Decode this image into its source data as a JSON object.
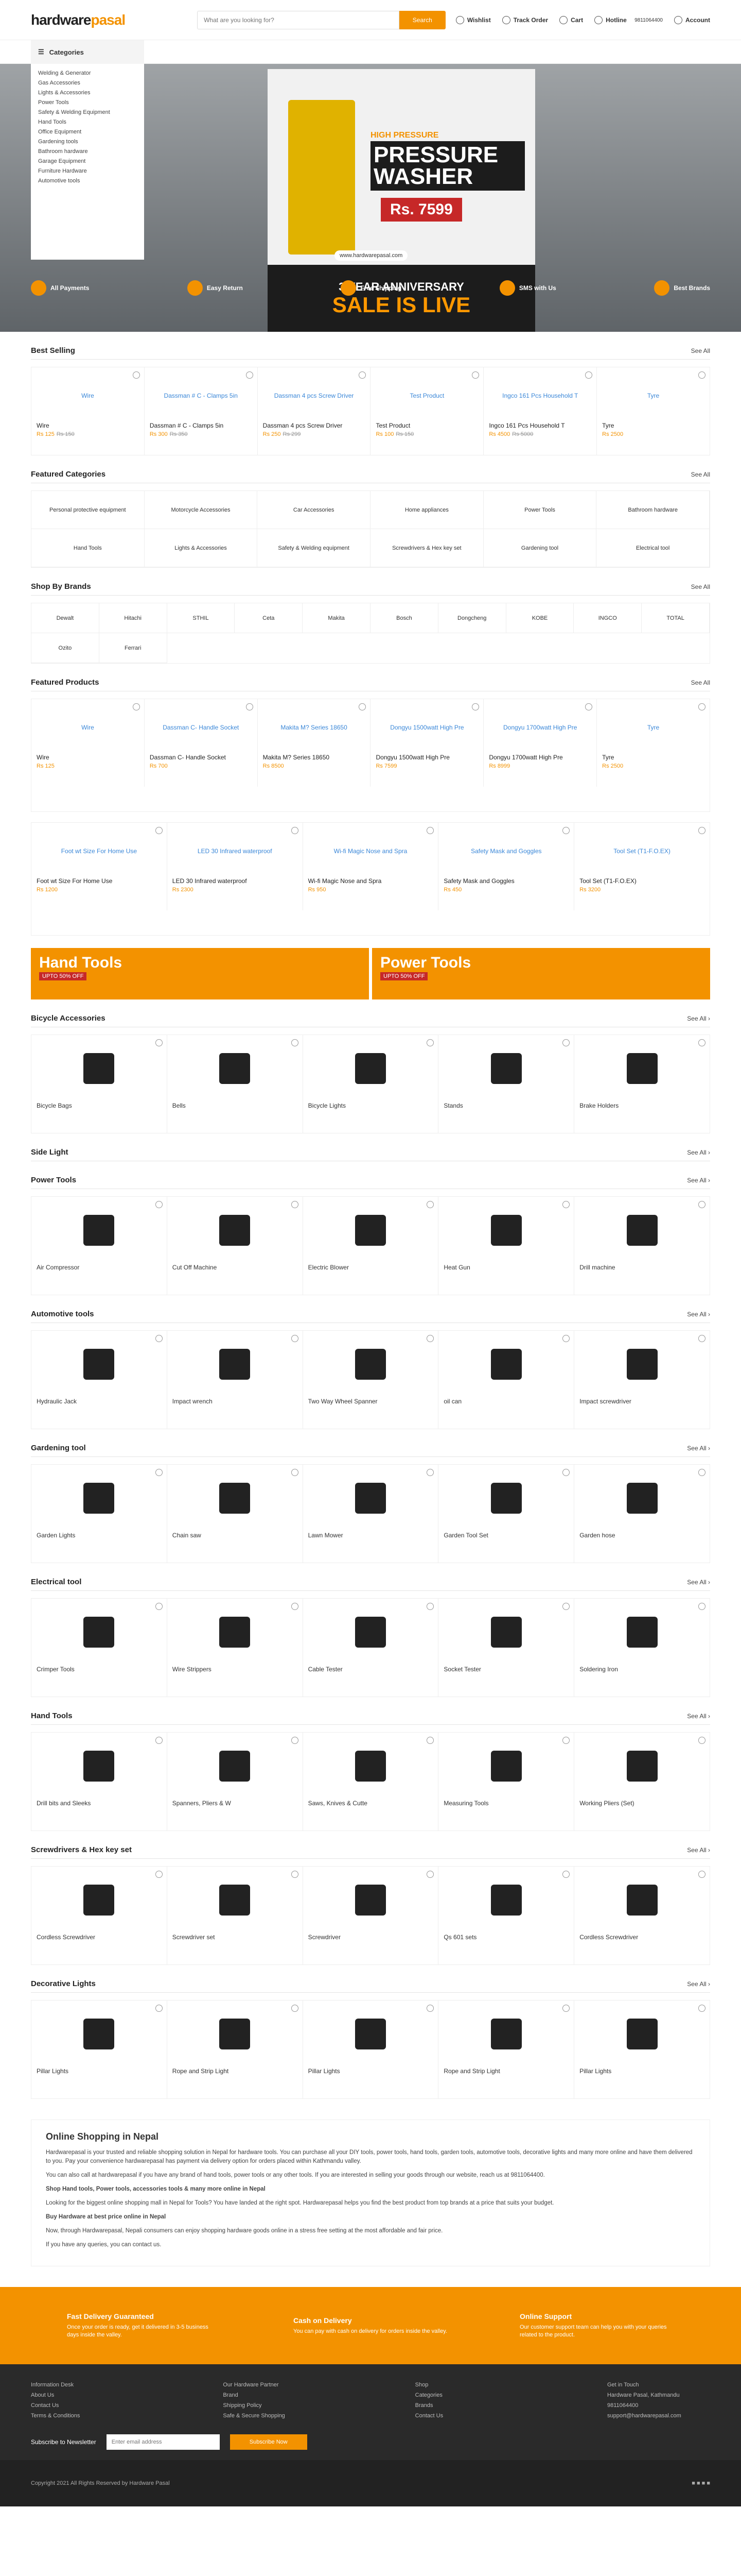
{
  "header": {
    "logo_a": "hardware",
    "logo_b": "pasal",
    "search_placeholder": "What are you looking for?",
    "search_btn": "Search",
    "wishlist": "Wishlist",
    "track": "Track Order",
    "cart": "Cart",
    "hotline": "Hotline",
    "phone": "9811064400",
    "account": "Account",
    "categories": "Categories"
  },
  "sidebar": [
    "Welding & Generator",
    "Gas Accessories",
    "Lights & Accessories",
    "Power Tools",
    "Safety & Welding Equipment",
    "Hand Tools",
    "Office Equipment",
    "Gardening tools",
    "Bathroom hardware",
    "Garage Equipment",
    "Furniture Hardware",
    "Automotive tools"
  ],
  "hero": {
    "tag": "HIGH PRESSURE",
    "title": "PRESSURE WASHER",
    "price": "Rs. 7599",
    "url": "www.hardwarepasal.com",
    "anniv_1": "3 YEAR ANNIVERSARY",
    "anniv_2": "SALE IS LIVE"
  },
  "features": [
    "All Payments",
    "Easy Return",
    "Free Shipping",
    "SMS with Us",
    "Best Brands"
  ],
  "best_selling": {
    "title": "Best Selling",
    "see_all": "See All",
    "items": [
      {
        "name": "Wire",
        "price": "Rs 125",
        "old": "Rs 150"
      },
      {
        "name": "Dassman # C - Clamps 5in",
        "price": "Rs 300",
        "old": "Rs 350"
      },
      {
        "name": "Dassman 4 pcs Screw Driver",
        "price": "Rs 250",
        "old": "Rs 299"
      },
      {
        "name": "Test Product",
        "price": "Rs 100",
        "old": "Rs 150"
      },
      {
        "name": "Ingco 161 Pcs Household T",
        "price": "Rs 4500",
        "old": "Rs 5000"
      },
      {
        "name": "Tyre",
        "price": "Rs 2500",
        "old": ""
      }
    ]
  },
  "featured_categories": {
    "title": "Featured Categories",
    "see_all": "See All",
    "items": [
      "Personal protective equipment",
      "Motorcycle Accessories",
      "Car Accessories",
      "Home appliances",
      "Power Tools",
      "Bathroom hardware",
      "Hand Tools",
      "Lights & Accessories",
      "Safety & Welding equipment",
      "Screwdrivers & Hex key set",
      "Gardening tool",
      "Electrical tool"
    ]
  },
  "brands": {
    "title": "Shop By Brands",
    "see_all": "See All",
    "items": [
      "Dewalt",
      "Hitachi",
      "STHIL",
      "Ceta",
      "Makita",
      "Bosch",
      "Dongcheng",
      "KOBE",
      "INGCO",
      "TOTAL",
      "Ozito",
      "Ferrari"
    ]
  },
  "featured_products": {
    "title": "Featured Products",
    "see_all": "See All",
    "row1": [
      {
        "name": "Wire",
        "price": "Rs 125"
      },
      {
        "name": "Dassman C- Handle Socket",
        "price": "Rs 700"
      },
      {
        "name": "Makita M? Series 18650",
        "price": "Rs 8500"
      },
      {
        "name": "Dongyu 1500watt High Pre",
        "price": "Rs 7599"
      },
      {
        "name": "Dongyu 1700watt High Pre",
        "price": "Rs 8999"
      },
      {
        "name": "Tyre",
        "price": "Rs 2500"
      }
    ],
    "row2": [
      {
        "name": "Foot wt Size For Home Use",
        "price": "Rs 1200"
      },
      {
        "name": "LED 30 Infrared waterproof",
        "price": "Rs 2300"
      },
      {
        "name": "Wi-fi Magic Nose and Spra",
        "price": "Rs 950"
      },
      {
        "name": "Safety Mask and Goggles",
        "price": "Rs 450"
      },
      {
        "name": "Tool Set (T1-F.O.EX)",
        "price": "Rs 3200"
      }
    ]
  },
  "banners": [
    {
      "title": "Hand Tools",
      "tag": "UPTO 50% OFF"
    },
    {
      "title": "Power Tools",
      "tag": "UPTO 50% OFF"
    }
  ],
  "sections": [
    {
      "title": "Bicycle Accessories",
      "items": [
        "Bicycle Bags",
        "Bells",
        "Bicycle Lights",
        "Stands",
        "Brake Holders"
      ]
    },
    {
      "title": "Side Light",
      "items": []
    },
    {
      "title": "Power Tools",
      "items": [
        "Air Compressor",
        "Cut Off Machine",
        "Electric Blower",
        "Heat Gun",
        "Drill machine"
      ]
    },
    {
      "title": "Automotive tools",
      "items": [
        "Hydraulic Jack",
        "Impact wrench",
        "Two Way Wheel Spanner",
        "oil can",
        "Impact screwdriver"
      ]
    },
    {
      "title": "Gardening tool",
      "items": [
        "Garden Lights",
        "Chain saw",
        "Lawn Mower",
        "Garden Tool Set",
        "Garden hose"
      ]
    },
    {
      "title": "Electrical tool",
      "items": [
        "Crimper Tools",
        "Wire Strippers",
        "Cable Tester",
        "Socket Tester",
        "Soldering Iron"
      ]
    },
    {
      "title": "Hand Tools",
      "items": [
        "Drill bits and Sleeks",
        "Spanners, Pliers & W",
        "Saws, Knives & Cutte",
        "Measuring Tools",
        "Working Pliers (Set)"
      ]
    },
    {
      "title": "Screwdrivers & Hex key set",
      "items": [
        "Cordless Screwdriver",
        "Screwdriver set",
        "Screwdriver",
        "Qs 601 sets",
        "Cordless Screwdriver"
      ]
    },
    {
      "title": "Decorative Lights",
      "items": [
        "Pillar Lights",
        "Rope and Strip Light",
        "Pillar Lights",
        "Rope and Strip Light",
        "Pillar Lights"
      ]
    }
  ],
  "about": {
    "title": "Online Shopping in Nepal",
    "p1": "Hardwarepasal is your trusted and reliable shopping solution in Nepal for hardware tools. You can purchase all your DIY tools, power tools, hand tools, garden tools, automotive tools, decorative lights and many more online and have them delivered to you. Pay your convenience hardwarepasal has payment via delivery option for orders placed within Kathmandu valley.",
    "p2": "You can also call at hardwarepasal if you have any brand of hand tools, power tools or any other tools. If you are interested in selling your goods through our website, reach us at 9811064400.",
    "h": "Shop Hand tools, Power tools, accessories tools & many more online in Nepal",
    "p3": "Looking for the biggest online shopping mall in Nepal for Tools? You have landed at the right spot. Hardwarepasal helps you find the best product from top brands at a price that suits your budget.",
    "p4": "Buy Hardware at best price online in Nepal",
    "p5": "Now, through Hardwarepasal, Nepali consumers can enjoy shopping hardware goods online in a stress free setting at the most affordable and fair price.",
    "p6": "If you have any queries, you can contact us."
  },
  "services": [
    {
      "title": "Fast Delivery Guaranteed",
      "text": "Once your order is ready, get it delivered in 3-5 business days inside the valley."
    },
    {
      "title": "Cash on Delivery",
      "text": "You can pay with cash on delivery for orders inside the valley."
    },
    {
      "title": "Online Support",
      "text": "Our customer support team can help you with your queries related to the product."
    }
  ],
  "footer": {
    "cols": [
      [
        "Information Desk",
        "About Us",
        "Contact Us",
        "Terms & Conditions"
      ],
      [
        "Our Hardware Partner",
        "Brand",
        "Shipping Policy",
        "Safe & Secure Shopping"
      ],
      [
        "Shop",
        "Categories",
        "Brands",
        "Contact Us"
      ],
      [
        "Get in Touch",
        "Hardware Pasal, Kathmandu",
        "9811064400",
        "support@hardwarepasal.com"
      ]
    ],
    "newsletter": "Subscribe to Newsletter",
    "email_ph": "Enter email address",
    "subscribe": "Subscribe Now",
    "copy": "Copyright 2021 All Rights Reserved by Hardware Pasal"
  }
}
